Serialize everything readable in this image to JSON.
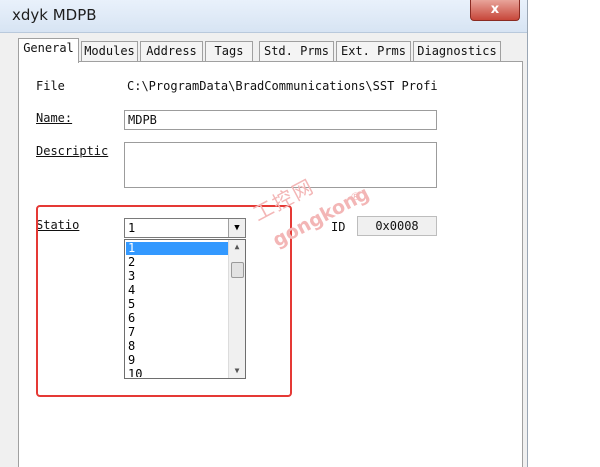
{
  "window": {
    "title": "xdyk MDPB",
    "close_label": "x"
  },
  "tabs": [
    {
      "label": "General"
    },
    {
      "label": "Modules"
    },
    {
      "label": "Address"
    },
    {
      "label": "Tags"
    },
    {
      "label": "Std. Prms"
    },
    {
      "label": "Ext. Prms"
    },
    {
      "label": "Diagnostics"
    }
  ],
  "general": {
    "file_label": "File",
    "file_value": "C:\\ProgramData\\BradCommunications\\SST Profibu",
    "name_label": "Name:",
    "name_value": "MDPB",
    "description_label": "Descriptic",
    "description_value": "",
    "station_label": "Statio",
    "station_value": "1",
    "station_options": [
      "1",
      "2",
      "3",
      "4",
      "5",
      "6",
      "7",
      "8",
      "9",
      "10"
    ],
    "id_label": "ID",
    "id_value": "0x0008"
  },
  "watermark": {
    "chinese": "工控网",
    "latin": "gongkong",
    "reg": "®"
  },
  "colors": {
    "highlight": "#e53935",
    "selection": "#3399ff"
  }
}
